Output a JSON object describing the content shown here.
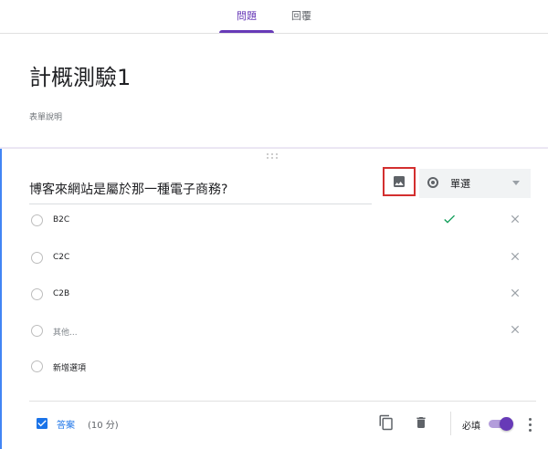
{
  "tabs": [
    {
      "label": "問題",
      "active": true
    },
    {
      "label": "回覆",
      "active": false
    }
  ],
  "form": {
    "title": "計概測驗1",
    "description": "表單說明"
  },
  "question": {
    "text": "博客來網站是屬於那一種電子商務?",
    "type_label": "單選",
    "options": [
      {
        "label": "B2C",
        "correct": true
      },
      {
        "label": "C2C",
        "correct": false
      },
      {
        "label": "C2B",
        "correct": false
      },
      {
        "label": "其他...",
        "correct": false
      }
    ],
    "add_option": "新增選項"
  },
  "footer": {
    "answer_label": "答案",
    "points": "(10 分)",
    "required_label": "必填",
    "required_on": true
  },
  "colors": {
    "accent": "#673ab7",
    "background": "#f0ebf8",
    "answer_blue": "#1a73e8",
    "check_green": "#0f9d58",
    "highlight_red": "#d32f2f",
    "card_left_border": "#4285f4"
  },
  "icons": {
    "image": "image-icon",
    "type": "radio-button-icon",
    "dropdown": "dropdown-arrow-icon",
    "check": "check-icon",
    "remove": "close-icon",
    "answer": "checkbox-checked-icon",
    "copy": "copy-icon",
    "delete": "trash-icon",
    "more": "more-vert-icon"
  }
}
